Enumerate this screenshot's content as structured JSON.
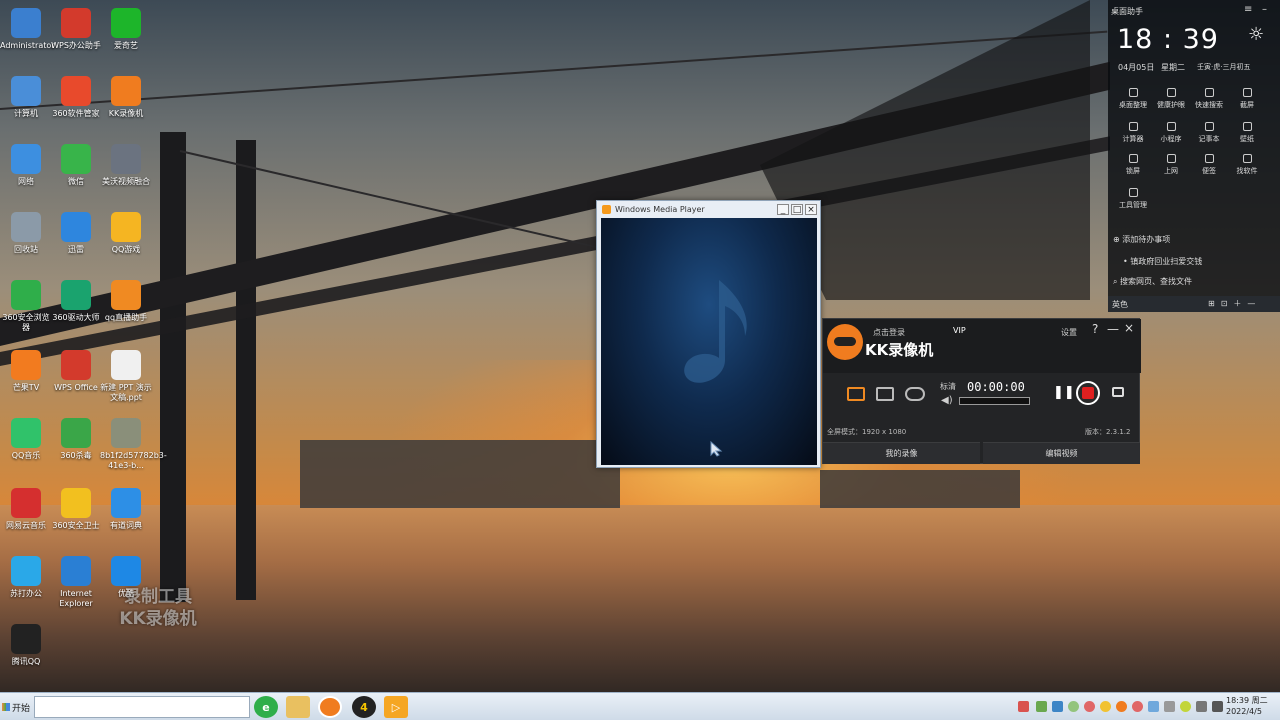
{
  "desktop": {
    "icons": [
      {
        "label": "Administrator",
        "icon": "folder-icon",
        "color": "#3b7fcf"
      },
      {
        "label": "WPS办公助手",
        "icon": "wps-icon",
        "color": "#d33a2c"
      },
      {
        "label": "爱奇艺",
        "icon": "iqiyi-icon",
        "color": "#1db52a"
      },
      {
        "label": "计算机",
        "icon": "computer-icon",
        "color": "#4a8ed8"
      },
      {
        "label": "360软件管家",
        "icon": "software-manager-icon",
        "color": "#e84a2c"
      },
      {
        "label": "KK录像机",
        "icon": "kk-recorder-icon",
        "color": "#f07c1f"
      },
      {
        "label": "网络",
        "icon": "network-icon",
        "color": "#3d8fe0"
      },
      {
        "label": "微信",
        "icon": "wechat-icon",
        "color": "#38b44a"
      },
      {
        "label": "美沃视频融合",
        "icon": "camera-icon",
        "color": "#6b7380"
      },
      {
        "label": "回收站",
        "icon": "recycle-bin-icon",
        "color": "#8b9aa8"
      },
      {
        "label": "迅雷",
        "icon": "thunder-icon",
        "color": "#2e86de"
      },
      {
        "label": "QQ游戏",
        "icon": "qq-game-icon",
        "color": "#f5b522"
      },
      {
        "label": "360安全浏览器",
        "icon": "360-browser-icon",
        "color": "#2fae4a"
      },
      {
        "label": "360驱动大师",
        "icon": "driver-master-icon",
        "color": "#1aa36e"
      },
      {
        "label": "qq直播助手",
        "icon": "qq-live-icon",
        "color": "#f08a22"
      },
      {
        "label": "芒果TV",
        "icon": "mango-tv-icon",
        "color": "#f27b1f"
      },
      {
        "label": "WPS Office",
        "icon": "wps-office-icon",
        "color": "#d33a2c"
      },
      {
        "label": "新建 PPT 演示文稿.ppt",
        "icon": "ppt-file-icon",
        "color": "#f0f0f0"
      },
      {
        "label": "QQ音乐",
        "icon": "qq-music-icon",
        "color": "#30c26a"
      },
      {
        "label": "360杀毒",
        "icon": "360-antivirus-icon",
        "color": "#3aa648"
      },
      {
        "label": "8b1f2d57782b3-41e3-b...",
        "icon": "image-file-icon",
        "color": "#8a8f7a"
      },
      {
        "label": "网易云音乐",
        "icon": "netease-music-icon",
        "color": "#d52f2f"
      },
      {
        "label": "360安全卫士",
        "icon": "360-guard-icon",
        "color": "#f2c01f"
      },
      {
        "label": "有道词典",
        "icon": "youdao-icon",
        "color": "#2d8fe6"
      },
      {
        "label": "苏打办公",
        "icon": "suda-office-icon",
        "color": "#2aa8e8"
      },
      {
        "label": "Internet Explorer",
        "icon": "ie-icon",
        "color": "#2a7fd4"
      },
      {
        "label": "优酷",
        "icon": "youku-icon",
        "color": "#1e88e5"
      },
      {
        "label": "腾讯QQ",
        "icon": "qq-icon",
        "color": "#222222"
      }
    ],
    "watermark_line1": "录制工具",
    "watermark_line2": "KK录像机"
  },
  "taskbar": {
    "start_label": "开始",
    "clock_time": "18:39 周二",
    "clock_date": "2022/4/5"
  },
  "wmp": {
    "title": "Windows Media Player",
    "minimize": "_",
    "maximize": "□",
    "close": "×"
  },
  "kk_recorder": {
    "login": "点击登录",
    "vip": "VIP",
    "settings": "设置",
    "help": "?",
    "minimize": "—",
    "close": "×",
    "app_name": "KK录像机",
    "quality": "标清",
    "timer": "00:00:00",
    "fullscreen_mode": "全屏模式：1920 x 1080",
    "version": "版本：2.3.1.2",
    "tab_recordings": "我的录像",
    "tab_edit": "编辑视频",
    "record_color": "#e02020"
  },
  "assistant": {
    "title": "桌面助手",
    "time": "18 : 39",
    "date": "04月05日",
    "weekday": "星期二",
    "lunar": "壬寅·虎·三月初五",
    "tools": [
      {
        "label": "桌面整理",
        "icon": "desktop-organize-icon"
      },
      {
        "label": "健康护眼",
        "icon": "eye-care-icon"
      },
      {
        "label": "快速搜索",
        "icon": "quick-search-icon"
      },
      {
        "label": "截屏",
        "icon": "screenshot-icon"
      },
      {
        "label": "计算器",
        "icon": "calculator-icon"
      },
      {
        "label": "小程序",
        "icon": "mini-program-icon"
      },
      {
        "label": "记事本",
        "icon": "notepad-icon"
      },
      {
        "label": "壁纸",
        "icon": "wallpaper-icon"
      },
      {
        "label": "锁屏",
        "icon": "lock-icon"
      },
      {
        "label": "上网",
        "icon": "globe-icon"
      },
      {
        "label": "便签",
        "icon": "sticky-note-icon"
      },
      {
        "label": "找软件",
        "icon": "find-software-icon"
      },
      {
        "label": "工具管理",
        "icon": "plus-icon"
      }
    ],
    "add_todo": "添加待办事项",
    "todo_item": "镇政府回业扫爱交钱",
    "search_placeholder": "搜索网页、查找文件",
    "bottom_label": "英色"
  }
}
